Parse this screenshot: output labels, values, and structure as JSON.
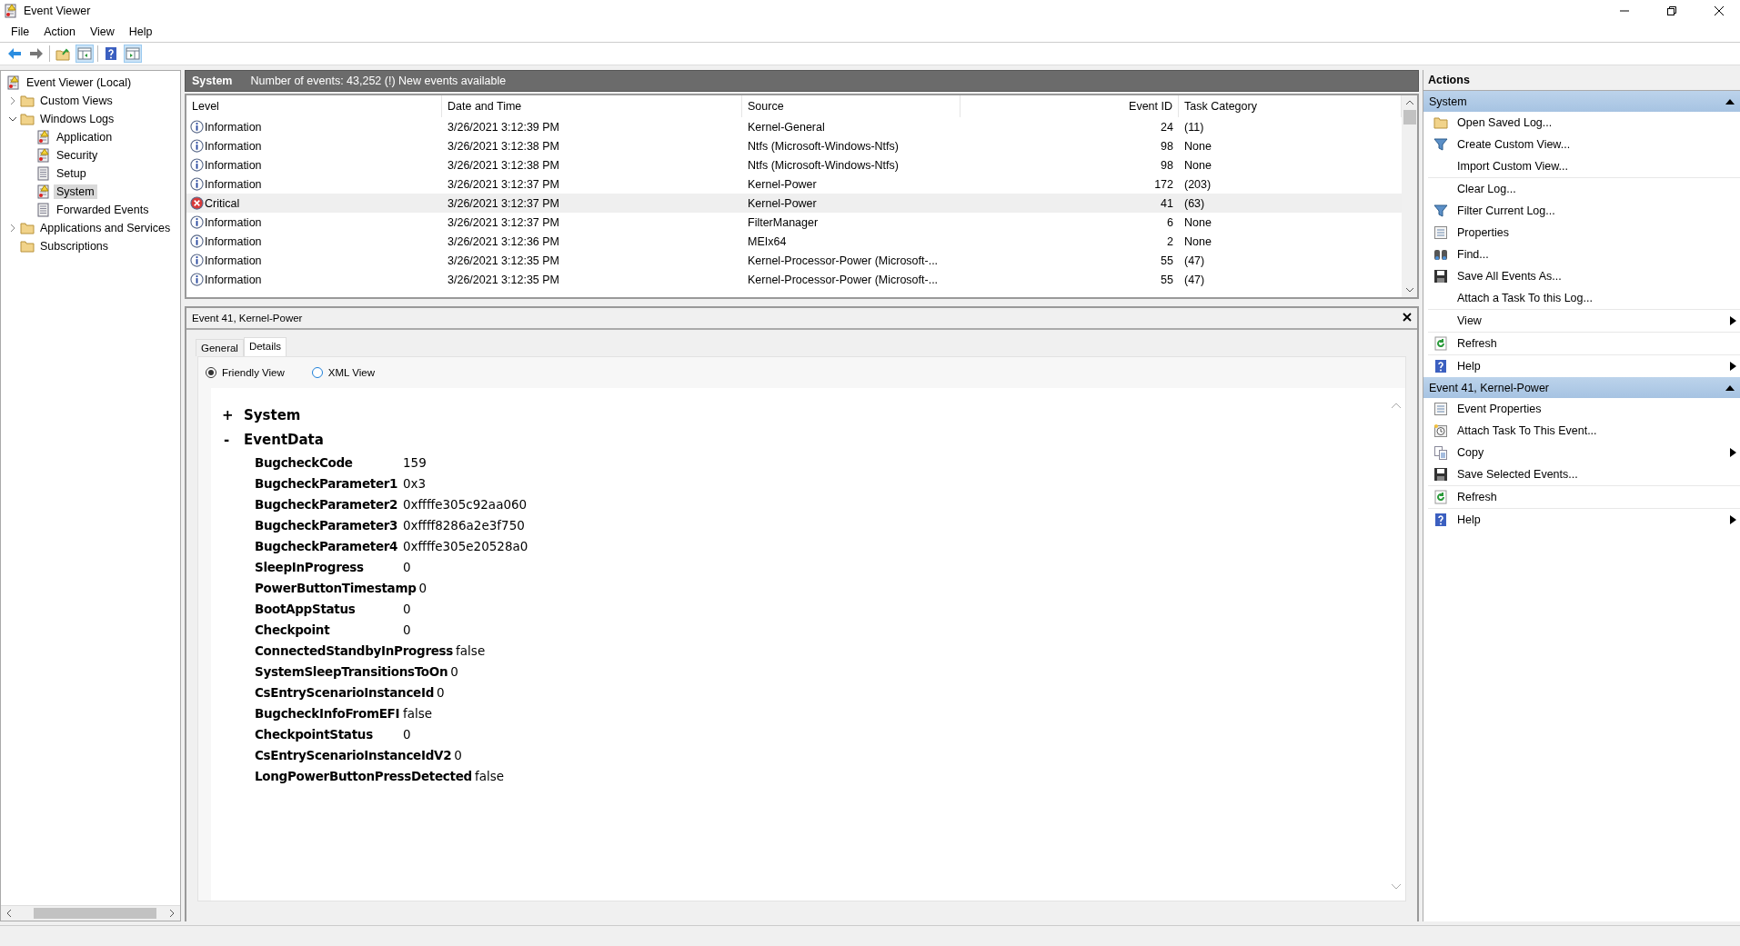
{
  "window": {
    "title": "Event Viewer"
  },
  "menu": [
    "File",
    "Action",
    "View",
    "Help"
  ],
  "tree": [
    {
      "label": "Event Viewer (Local)",
      "kind": "viewer",
      "selected": false,
      "children": [
        {
          "label": "Custom Views",
          "kind": "folder",
          "expanded": false,
          "selected": false
        },
        {
          "label": "Windows Logs",
          "kind": "folder",
          "expanded": true,
          "selected": false,
          "children": [
            {
              "label": "Application",
              "kind": "log",
              "selected": false
            },
            {
              "label": "Security",
              "kind": "log",
              "selected": false
            },
            {
              "label": "Setup",
              "kind": "log-plain",
              "selected": false
            },
            {
              "label": "System",
              "kind": "log",
              "selected": true
            },
            {
              "label": "Forwarded Events",
              "kind": "log-plain",
              "selected": false
            }
          ]
        },
        {
          "label": "Applications and Services",
          "kind": "folder",
          "expanded": false,
          "selected": false
        },
        {
          "label": "Subscriptions",
          "kind": "folder",
          "selected": false
        }
      ]
    }
  ],
  "summary": {
    "title": "System",
    "text": "Number of events: 43,252 (!) New events available"
  },
  "table": {
    "columns": [
      "Level",
      "Date and Time",
      "Source",
      "Event ID",
      "Task Category"
    ],
    "rows": [
      {
        "kind": "information",
        "level": "Information",
        "date": "3/26/2021 3:12:39 PM",
        "source": "Kernel-General",
        "event_id": "24",
        "task_category": "(11)",
        "selected": false
      },
      {
        "kind": "information",
        "level": "Information",
        "date": "3/26/2021 3:12:38 PM",
        "source": "Ntfs (Microsoft-Windows-Ntfs)",
        "event_id": "98",
        "task_category": "None",
        "selected": false
      },
      {
        "kind": "information",
        "level": "Information",
        "date": "3/26/2021 3:12:38 PM",
        "source": "Ntfs (Microsoft-Windows-Ntfs)",
        "event_id": "98",
        "task_category": "None",
        "selected": false
      },
      {
        "kind": "information",
        "level": "Information",
        "date": "3/26/2021 3:12:37 PM",
        "source": "Kernel-Power",
        "event_id": "172",
        "task_category": "(203)",
        "selected": false
      },
      {
        "kind": "critical",
        "level": "Critical",
        "date": "3/26/2021 3:12:37 PM",
        "source": "Kernel-Power",
        "event_id": "41",
        "task_category": "(63)",
        "selected": true
      },
      {
        "kind": "information",
        "level": "Information",
        "date": "3/26/2021 3:12:37 PM",
        "source": "FilterManager",
        "event_id": "6",
        "task_category": "None",
        "selected": false
      },
      {
        "kind": "information",
        "level": "Information",
        "date": "3/26/2021 3:12:36 PM",
        "source": "MEIx64",
        "event_id": "2",
        "task_category": "None",
        "selected": false
      },
      {
        "kind": "information",
        "level": "Information",
        "date": "3/26/2021 3:12:35 PM",
        "source": "Kernel-Processor-Power (Microsoft-...",
        "event_id": "55",
        "task_category": "(47)",
        "selected": false
      },
      {
        "kind": "information",
        "level": "Information",
        "date": "3/26/2021 3:12:35 PM",
        "source": "Kernel-Processor-Power (Microsoft-...",
        "event_id": "55",
        "task_category": "(47)",
        "selected": false
      }
    ]
  },
  "detail": {
    "title": "Event 41, Kernel-Power",
    "tabs": [
      {
        "label": "General",
        "selected": false
      },
      {
        "label": "Details",
        "selected": true
      }
    ],
    "view_options": [
      {
        "label": "Friendly View",
        "selected": true
      },
      {
        "label": "XML View",
        "selected": false
      }
    ],
    "sections": [
      {
        "toggle": "+",
        "name": "System"
      },
      {
        "toggle": "-",
        "name": "EventData",
        "fields": [
          {
            "name": "BugcheckCode",
            "value": "159"
          },
          {
            "name": "BugcheckParameter1",
            "value": "0x3"
          },
          {
            "name": "BugcheckParameter2",
            "value": "0xffffe305c92aa060"
          },
          {
            "name": "BugcheckParameter3",
            "value": "0xffff8286a2e3f750"
          },
          {
            "name": "BugcheckParameter4",
            "value": "0xffffe305e20528a0"
          },
          {
            "name": "SleepInProgress",
            "value": "0"
          },
          {
            "name": "PowerButtonTimestamp",
            "value": "0"
          },
          {
            "name": "BootAppStatus",
            "value": "0"
          },
          {
            "name": "Checkpoint",
            "value": "0"
          },
          {
            "name": "ConnectedStandbyInProgress",
            "value": "false"
          },
          {
            "name": "SystemSleepTransitionsToOn",
            "value": "0"
          },
          {
            "name": "CsEntryScenarioInstanceId",
            "value": "0"
          },
          {
            "name": "BugcheckInfoFromEFI",
            "value": "false"
          },
          {
            "name": "CheckpointStatus",
            "value": "0"
          },
          {
            "name": "CsEntryScenarioInstanceIdV2",
            "value": "0"
          },
          {
            "name": "LongPowerButtonPressDetected",
            "value": "false"
          }
        ]
      }
    ]
  },
  "actions": {
    "title": "Actions",
    "sections": [
      {
        "title": "System",
        "items": [
          {
            "label": "Open Saved Log...",
            "kind": "folder",
            "submenu": false,
            "divider_after": false
          },
          {
            "label": "Create Custom View...",
            "kind": "funnel",
            "submenu": false,
            "divider_after": false
          },
          {
            "label": "Import Custom View...",
            "kind": "none",
            "submenu": false,
            "divider_after": true
          },
          {
            "label": "Clear Log...",
            "kind": "none",
            "submenu": false,
            "divider_after": false
          },
          {
            "label": "Filter Current Log...",
            "kind": "funnel",
            "submenu": false,
            "divider_after": false
          },
          {
            "label": "Properties",
            "kind": "properties",
            "submenu": false,
            "divider_after": false
          },
          {
            "label": "Find...",
            "kind": "binoculars",
            "submenu": false,
            "divider_after": false
          },
          {
            "label": "Save All Events As...",
            "kind": "floppy",
            "submenu": false,
            "divider_after": false
          },
          {
            "label": "Attach a Task To this Log...",
            "kind": "none",
            "submenu": false,
            "divider_after": true
          },
          {
            "label": "View",
            "kind": "none",
            "submenu": true,
            "divider_after": true
          },
          {
            "label": "Refresh",
            "kind": "refresh",
            "submenu": false,
            "divider_after": true
          },
          {
            "label": "Help",
            "kind": "help",
            "submenu": true,
            "divider_after": false
          }
        ]
      },
      {
        "title": "Event 41, Kernel-Power",
        "items": [
          {
            "label": "Event Properties",
            "kind": "properties",
            "submenu": false,
            "divider_after": false
          },
          {
            "label": "Attach Task To This Event...",
            "kind": "clock",
            "submenu": false,
            "divider_after": false
          },
          {
            "label": "Copy",
            "kind": "copy",
            "submenu": true,
            "divider_after": false
          },
          {
            "label": "Save Selected Events...",
            "kind": "floppy",
            "submenu": false,
            "divider_after": true
          },
          {
            "label": "Refresh",
            "kind": "refresh",
            "submenu": false,
            "divider_after": true
          },
          {
            "label": "Help",
            "kind": "help",
            "submenu": true,
            "divider_after": false
          }
        ]
      }
    ]
  }
}
